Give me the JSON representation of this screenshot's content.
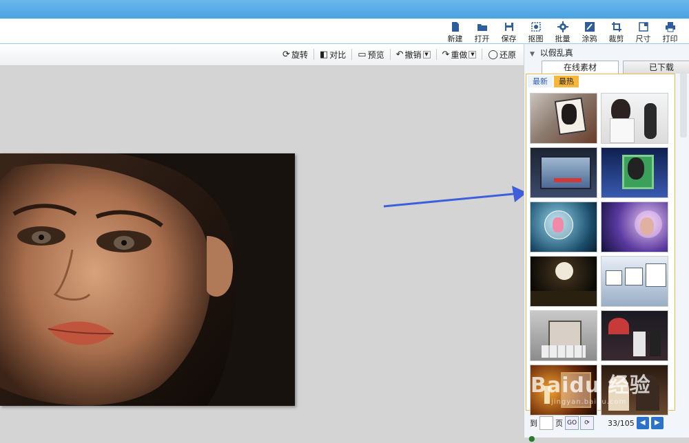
{
  "toolbar": {
    "items": [
      {
        "label": "新建",
        "icon": "new-file-icon"
      },
      {
        "label": "打开",
        "icon": "folder-open-icon"
      },
      {
        "label": "保存",
        "icon": "save-icon"
      },
      {
        "label": "抠图",
        "icon": "cutout-icon"
      },
      {
        "label": "批量",
        "icon": "batch-gear-icon"
      },
      {
        "label": "涂鸦",
        "icon": "doodle-icon"
      },
      {
        "label": "裁剪",
        "icon": "crop-icon"
      },
      {
        "label": "尺寸",
        "icon": "resize-icon"
      },
      {
        "label": "打印",
        "icon": "printer-icon"
      }
    ]
  },
  "controls": {
    "rotate": "旋转",
    "compare": "对比",
    "preview": "预览",
    "undo": "撤销",
    "redo": "重做",
    "restore": "还原"
  },
  "sidebar": {
    "title": "以假乱真",
    "tabs": [
      "在线素材",
      "已下载"
    ],
    "subtabs": [
      "最新",
      "最热"
    ],
    "pager": {
      "goto_label": "到",
      "page_label": "页",
      "go_label": "GO",
      "page_info": "33/105"
    }
  },
  "watermark": {
    "text": "Baidu 经验",
    "sub": "jingyan.baidu.com"
  },
  "colors": {
    "accent": "#4aa3e3",
    "tab_active": "#f7b73b",
    "arrow": "#3e5fd8"
  }
}
